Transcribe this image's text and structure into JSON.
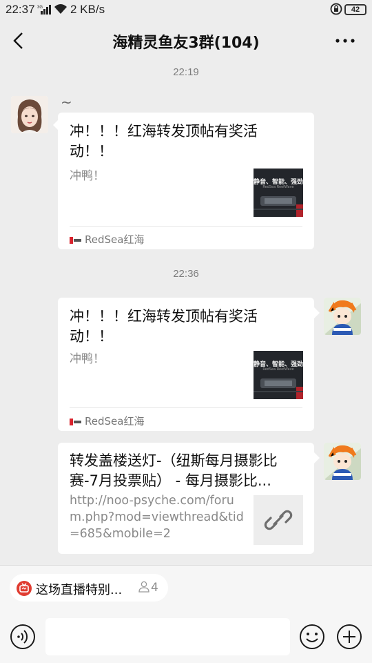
{
  "status_bar": {
    "time": "22:37",
    "network": "3G",
    "speed": "2 KB/s",
    "battery": "42"
  },
  "nav": {
    "title": "海精灵鱼友3群(104)"
  },
  "messages": [
    {
      "timestamp": "22:19",
      "sender_name": "~",
      "title": "冲！！！红海转发顶帖有奖活动！！",
      "description": "冲鸭！",
      "thumb_text": "静音、智能、强劲",
      "thumb_subtext": "RedSea ReefWave",
      "source": "RedSea红海"
    },
    {
      "timestamp": "22:36",
      "title": "冲！！！红海转发顶帖有奖活动！！",
      "description": "冲鸭！",
      "thumb_text": "静音、智能、强劲",
      "thumb_subtext": "RedSea ReefWave",
      "source": "RedSea红海"
    },
    {
      "title": "转发盖楼送灯-（纽斯每月摄影比赛-7月投票贴） - 每月摄影比...",
      "url": "http://noo-psyche.com/forum.php?mod=viewthread&tid=685&mobile=2"
    }
  ],
  "bottom": {
    "live_text": "这场直播特别...",
    "live_count": "4"
  },
  "icons": {
    "back": "back-arrow-icon",
    "more": "more-dots-icon",
    "voice": "voice-icon",
    "emoji": "emoji-icon",
    "plus": "plus-icon",
    "link": "link-icon",
    "live": "live-icon"
  },
  "colors": {
    "background": "#ededed",
    "bubble": "#ffffff",
    "live_red": "#e03c31"
  }
}
